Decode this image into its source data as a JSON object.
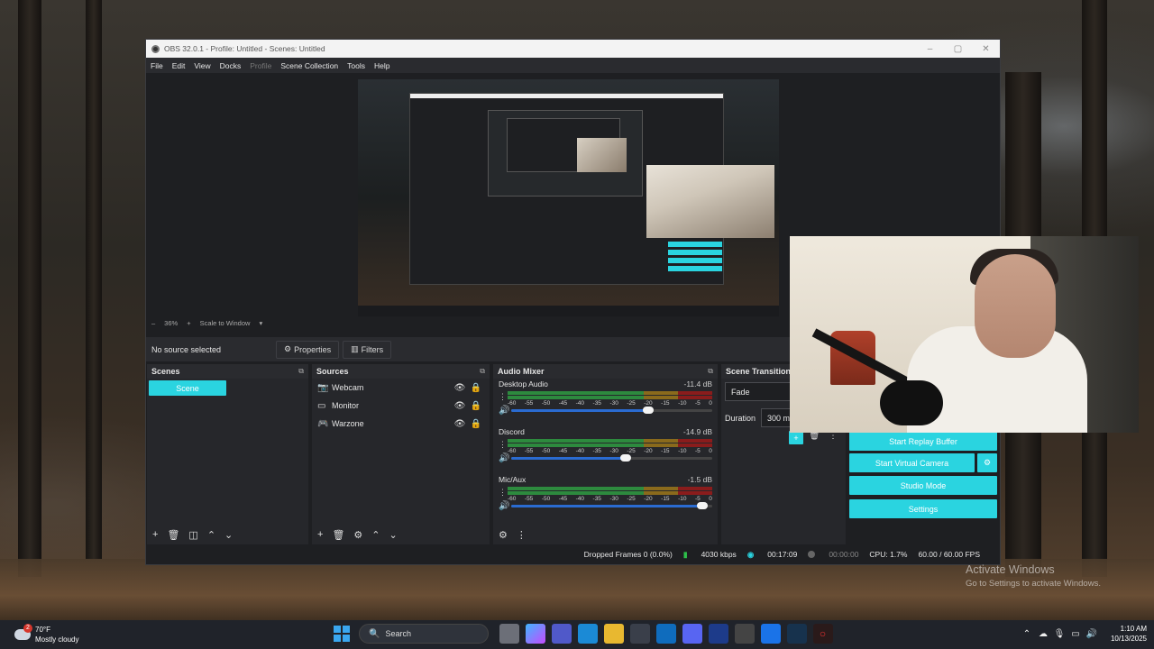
{
  "window": {
    "title": "OBS 32.0.1 - Profile: Untitled - Scenes: Untitled",
    "controls": [
      "–",
      "▢",
      "✕"
    ]
  },
  "menu": [
    "File",
    "Edit",
    "View",
    "Docks",
    "Profile",
    "Scene Collection",
    "Tools",
    "Help"
  ],
  "zoom": {
    "minus": "–",
    "level": "36%",
    "plus": "+",
    "mode": "Scale to Window",
    "caret": "▾"
  },
  "source_bar": {
    "status": "No source selected",
    "properties_label": "Properties",
    "filters_label": "Filters"
  },
  "scenes": {
    "title": "Scenes",
    "items": [
      "Scene"
    ]
  },
  "sources": {
    "title": "Sources",
    "items": [
      {
        "name": "Webcam",
        "icon": "camera-icon"
      },
      {
        "name": "Monitor",
        "icon": "monitor-icon"
      },
      {
        "name": "Warzone",
        "icon": "gamepad-icon"
      }
    ]
  },
  "audio_mixer": {
    "title": "Audio Mixer",
    "scale": [
      "-60",
      "-55",
      "-50",
      "-45",
      "-40",
      "-35",
      "-30",
      "-25",
      "-20",
      "-15",
      "-10",
      "-5",
      "0"
    ],
    "channels": [
      {
        "name": "Desktop Audio",
        "db": "-11.4 dB",
        "level": 0.68
      },
      {
        "name": "Discord",
        "db": "-14.9 dB",
        "level": 0.57
      },
      {
        "name": "Mic/Aux",
        "db": "-1.5 dB",
        "level": 0.95
      }
    ]
  },
  "transitions": {
    "title": "Scene Transitions",
    "selected": "Fade",
    "duration_label": "Duration",
    "duration_value": "300 ms"
  },
  "controls": {
    "replay_buffer": "Start Replay Buffer",
    "virtual_camera": "Start Virtual Camera",
    "studio_mode": "Studio Mode",
    "settings": "Settings"
  },
  "status": {
    "dropped": "Dropped Frames 0 (0.0%)",
    "bitrate": "4030 kbps",
    "live_time": "00:17:09",
    "rec_time": "00:00:00",
    "cpu": "CPU: 1.7%",
    "fps": "60.00 / 60.00 FPS"
  },
  "watermark": {
    "line1": "Activate Windows",
    "line2": "Go to Settings to activate Windows."
  },
  "taskbar": {
    "weather_badge": "2",
    "temp": "70°F",
    "condition": "Mostly cloudy",
    "search_placeholder": "Search",
    "time": "1:10 AM",
    "date": "10/13/2025"
  },
  "colors": {
    "accent": "#2ad4e0",
    "meter_green": "#2d8a3e",
    "fader_blue": "#2a6bd1"
  }
}
